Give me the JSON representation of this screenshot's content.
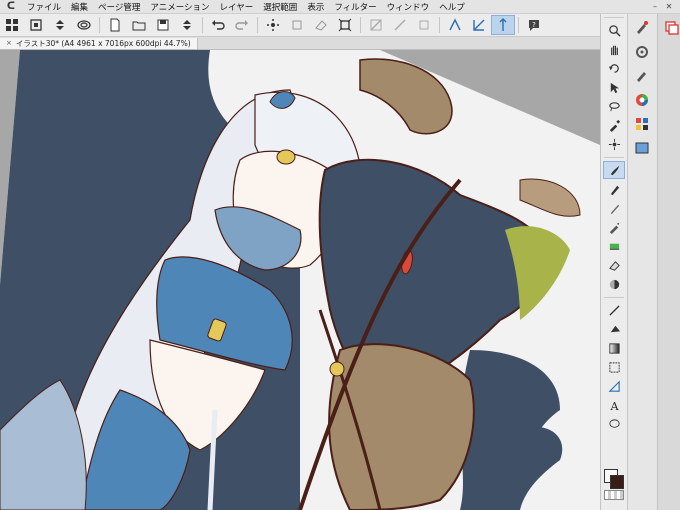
{
  "app": {
    "logo": "ᑕ"
  },
  "menu": {
    "items": [
      "ファイル",
      "編集",
      "ページ管理",
      "アニメーション",
      "レイヤー",
      "選択範囲",
      "表示",
      "フィルター",
      "ウィンドウ",
      "ヘルプ"
    ]
  },
  "window_controls": {
    "minimize": "–",
    "close": "✕"
  },
  "document_tab": {
    "close": "×",
    "title": "イラスト30* (A4 4961 x 7016px 600dpi 44.7%)"
  },
  "colors": {
    "accent": "#bcd3ec",
    "canvas_dark": "#3f4f66",
    "line_art": "#4a1f17",
    "outfit_blue": "#4f86b8",
    "brown": "#a38a6a"
  },
  "toolbar_icons": [
    "grid-icon",
    "canvas-icon",
    "stepper-icon",
    "spiral-icon",
    "new-file-icon",
    "open-file-icon",
    "save-icon",
    "stepper-icon",
    "undo-icon",
    "redo-icon",
    "sparkle-icon",
    "transform-icon",
    "eraser-icon",
    "fit-icon",
    "ruler-off-icon",
    "ruler-icon",
    "snap-icon",
    "perspective-icon",
    "snap-special-icon",
    "help-icon"
  ],
  "tools": [
    "zoom-icon",
    "hand-icon",
    "rotate-icon",
    "operation-icon",
    "lasso-icon",
    "eyedropper-icon",
    "selection-icon",
    "brush-icon",
    "pen-icon",
    "pencil-icon",
    "airbrush-icon",
    "decoration-icon",
    "eraser-icon",
    "blend-icon",
    "line-icon",
    "fill-icon",
    "gradient-icon",
    "figure-icon",
    "ruler-icon",
    "text-icon",
    "balloon-icon"
  ]
}
